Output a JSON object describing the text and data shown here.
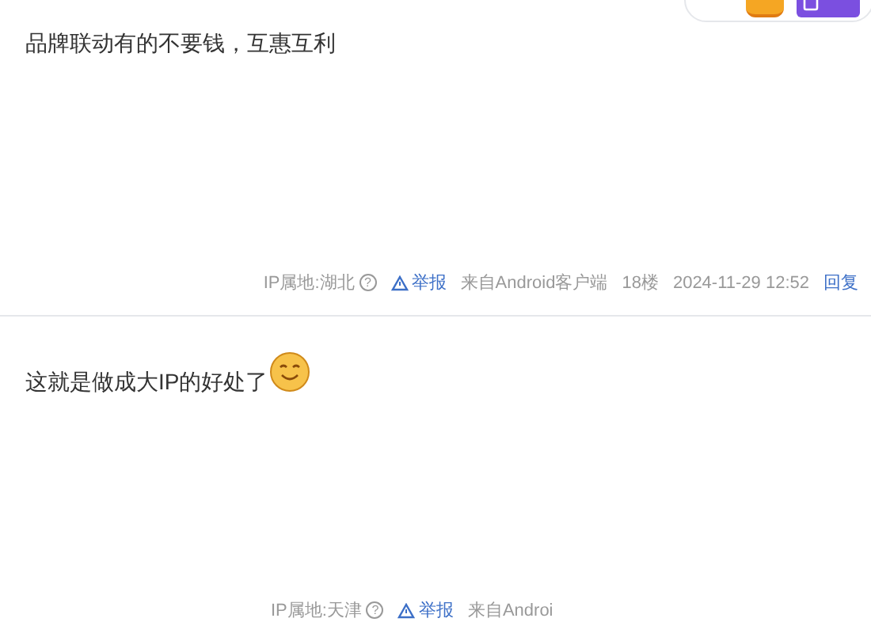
{
  "posts": [
    {
      "text": "品牌联动有的不要钱，互惠互利",
      "emoji": false,
      "footer": {
        "ip": "IP属地:湖北",
        "help": "?",
        "report": "举报",
        "source": "来自Android客户端",
        "floor": "18楼",
        "time": "2024-11-29 12:52",
        "reply": "回复"
      }
    },
    {
      "text": "这就是做成大IP的好处了",
      "emoji": true,
      "footer": {
        "ip": "IP属地:天津",
        "help": "?",
        "report": "举报",
        "source": "来自Androi"
      }
    }
  ]
}
